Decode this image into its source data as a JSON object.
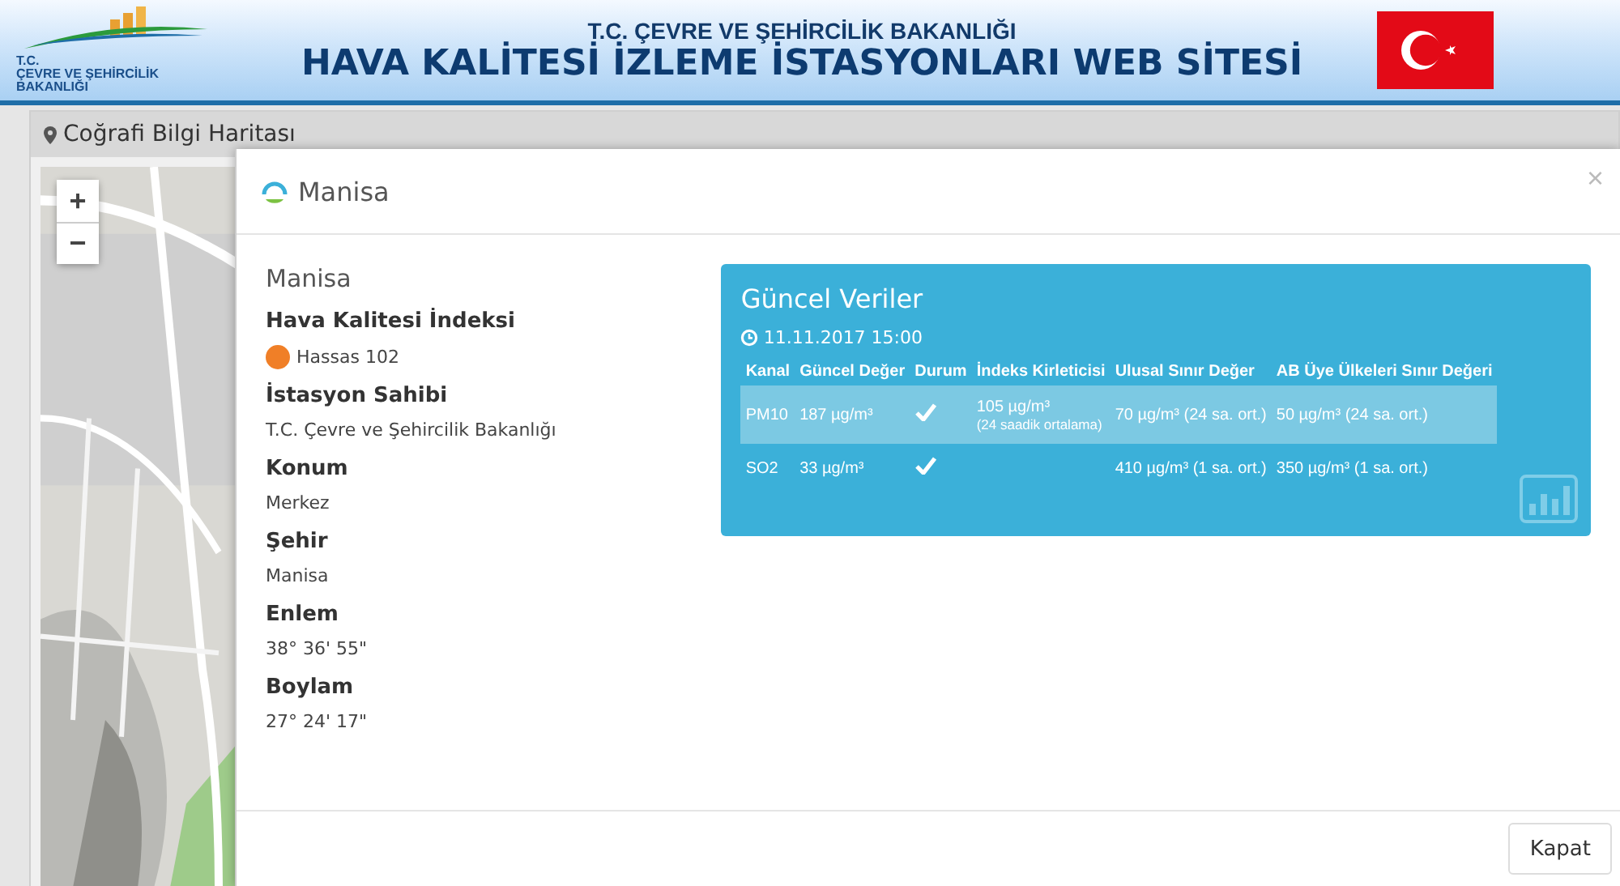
{
  "header": {
    "logo_text": [
      "T.C.",
      "ÇEVRE VE ŞEHİRCİLİK",
      "BAKANLIĞI"
    ],
    "ministry": "T.C. ÇEVRE VE ŞEHİRCİLİK BAKANLIĞI",
    "title": "HAVA KALİTESİ İZLEME İSTASYONLARI WEB SİTESİ"
  },
  "panel": {
    "title": "Coğrafi Bilgi Haritası",
    "map": {
      "kind": "picture",
      "zoom_in": "+",
      "zoom_out": "−"
    }
  },
  "modal": {
    "title": "Manisa",
    "close": "×",
    "station": "Manisa",
    "fields": [
      {
        "label": "Hava Kalitesi İndeksi",
        "value": "Hassas 102",
        "color": "#f07f27"
      },
      {
        "label": "İstasyon Sahibi",
        "value": "T.C. Çevre ve Şehircilik Bakanlığı"
      },
      {
        "label": "Konum",
        "value": "Merkez"
      },
      {
        "label": "Şehir",
        "value": "Manisa"
      },
      {
        "label": "Enlem",
        "value": "38° 36' 55\""
      },
      {
        "label": "Boylam",
        "value": "27° 24' 17\""
      }
    ],
    "card": {
      "title": "Güncel Veriler",
      "time": "11.11.2017 15:00",
      "columns": [
        "Kanal",
        "Güncel Değer",
        "Durum",
        "İndeks Kirleticisi",
        "Ulusal Sınır Değer",
        "AB Üye Ülkeleri Sınır Değeri"
      ],
      "rows": [
        {
          "selected": true,
          "channel": "PM10",
          "value": "187 µg/m³",
          "ok": true,
          "index": "105 µg/m³",
          "index_note": "(24 saadik ortalama)",
          "national": "70 µg/m³ (24 sa. ort.)",
          "eu": "50 µg/m³ (24 sa. ort.)"
        },
        {
          "selected": false,
          "channel": "SO2",
          "value": "33 µg/m³",
          "ok": true,
          "national": "410 µg/m³ (1 sa. ort.)",
          "eu": "350 µg/m³ (1 sa. ort.)"
        }
      ]
    },
    "buttons": [
      "Kapat"
    ]
  }
}
